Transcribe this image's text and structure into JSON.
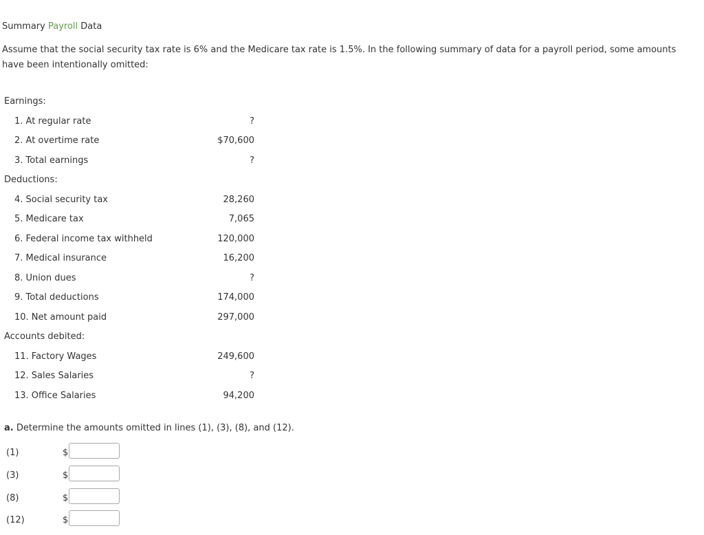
{
  "header": {
    "title_prefix": "Summary ",
    "title_accent": "Payroll",
    "title_suffix": " Data"
  },
  "intro": "Assume that the social security tax rate is 6% and the Medicare tax rate is 1.5%. In the following summary of data for a payroll period, some amounts have been intentionally omitted:",
  "summary": {
    "earnings_heading": "Earnings:",
    "earnings": [
      {
        "label": "1. At regular rate",
        "value": "?"
      },
      {
        "label": "2. At overtime rate",
        "value": "$70,600"
      },
      {
        "label": "3. Total earnings",
        "value": "?"
      }
    ],
    "deductions_heading": "Deductions:",
    "deductions": [
      {
        "label": "4. Social security tax",
        "value": "28,260"
      },
      {
        "label": "5. Medicare tax",
        "value": "7,065"
      },
      {
        "label": "6. Federal income tax withheld",
        "value": "120,000"
      },
      {
        "label": "7. Medical insurance",
        "value": "16,200"
      },
      {
        "label": "8. Union dues",
        "value": "?"
      },
      {
        "label": "9. Total deductions",
        "value": "174,000"
      },
      {
        "label": "10. Net amount paid",
        "value": "297,000"
      }
    ],
    "accounts_heading": "Accounts debited:",
    "accounts": [
      {
        "label": "11. Factory Wages",
        "value": "249,600"
      },
      {
        "label": "12. Sales Salaries",
        "value": "?"
      },
      {
        "label": "13. Office Salaries",
        "value": "94,200"
      }
    ]
  },
  "question": {
    "marker": "a.",
    "text": " Determine the amounts omitted in lines (1), (3), (8), and (12)."
  },
  "answers": [
    {
      "label": "(1)",
      "currency": "$",
      "value": ""
    },
    {
      "label": "(3)",
      "currency": "$",
      "value": ""
    },
    {
      "label": "(8)",
      "currency": "$",
      "value": ""
    },
    {
      "label": "(12)",
      "currency": "$",
      "value": ""
    }
  ]
}
